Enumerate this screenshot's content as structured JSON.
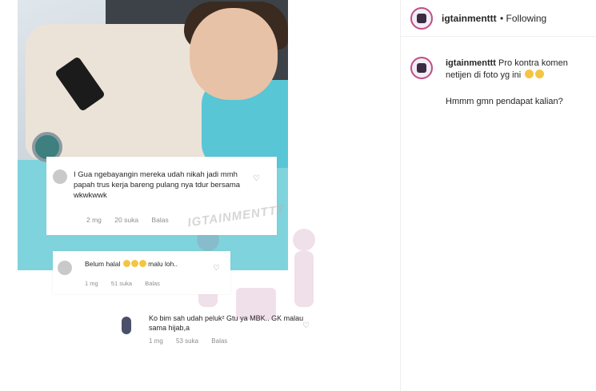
{
  "post": {
    "watermark": "IGTAINMENTTT",
    "comments": [
      {
        "text": "I Gua ngebayangin mereka udah nikah  jadi mmh papah trus kerja bareng pulang nya tdur bersama wkwkwwk",
        "time": "2 mg",
        "likes": "20 suka",
        "reply": "Balas"
      },
      {
        "text_prefix": "Belum halal",
        "text_suffix": "malu loh..",
        "time": "1 mg",
        "likes": "51 suka",
        "reply": "Balas"
      },
      {
        "text": "Ko bim sah udah peluk² Gtu ya MBK.. GK malau sama hijab,a",
        "time": "1 mg",
        "likes": "53 suka",
        "reply": "Balas"
      }
    ]
  },
  "sidebar": {
    "username": "igtainmenttt",
    "follow_status": "• Following",
    "caption_user": "igtainmenttt",
    "caption_text": "Pro kontra komen netijen di foto yg ini",
    "caption_line2": "Hmmm gmn pendapat kalian?"
  },
  "colors": {
    "accent": "#c24d84",
    "meta": "#8e8e8e",
    "pillow": "#59c6d6"
  }
}
